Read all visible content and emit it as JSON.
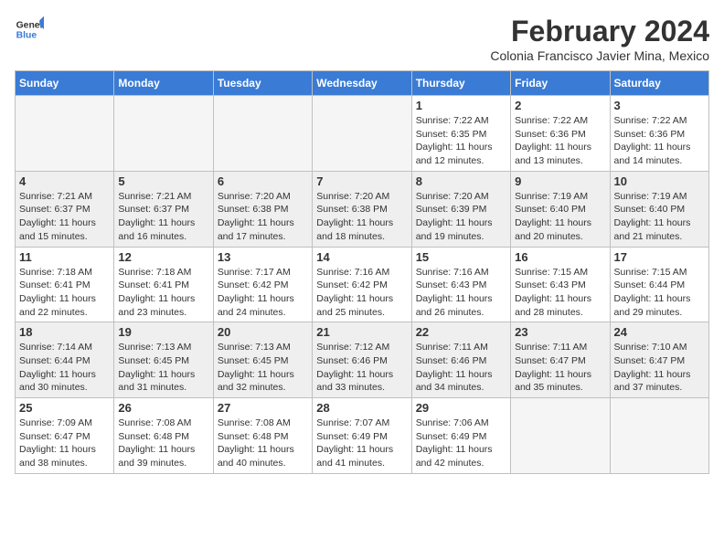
{
  "header": {
    "logo_general": "General",
    "logo_blue": "Blue",
    "month_year": "February 2024",
    "location": "Colonia Francisco Javier Mina, Mexico"
  },
  "days_of_week": [
    "Sunday",
    "Monday",
    "Tuesday",
    "Wednesday",
    "Thursday",
    "Friday",
    "Saturday"
  ],
  "weeks": [
    {
      "shaded": false,
      "days": [
        {
          "num": "",
          "info": ""
        },
        {
          "num": "",
          "info": ""
        },
        {
          "num": "",
          "info": ""
        },
        {
          "num": "",
          "info": ""
        },
        {
          "num": "1",
          "info": "Sunrise: 7:22 AM\nSunset: 6:35 PM\nDaylight: 11 hours\nand 12 minutes."
        },
        {
          "num": "2",
          "info": "Sunrise: 7:22 AM\nSunset: 6:36 PM\nDaylight: 11 hours\nand 13 minutes."
        },
        {
          "num": "3",
          "info": "Sunrise: 7:22 AM\nSunset: 6:36 PM\nDaylight: 11 hours\nand 14 minutes."
        }
      ]
    },
    {
      "shaded": true,
      "days": [
        {
          "num": "4",
          "info": "Sunrise: 7:21 AM\nSunset: 6:37 PM\nDaylight: 11 hours\nand 15 minutes."
        },
        {
          "num": "5",
          "info": "Sunrise: 7:21 AM\nSunset: 6:37 PM\nDaylight: 11 hours\nand 16 minutes."
        },
        {
          "num": "6",
          "info": "Sunrise: 7:20 AM\nSunset: 6:38 PM\nDaylight: 11 hours\nand 17 minutes."
        },
        {
          "num": "7",
          "info": "Sunrise: 7:20 AM\nSunset: 6:38 PM\nDaylight: 11 hours\nand 18 minutes."
        },
        {
          "num": "8",
          "info": "Sunrise: 7:20 AM\nSunset: 6:39 PM\nDaylight: 11 hours\nand 19 minutes."
        },
        {
          "num": "9",
          "info": "Sunrise: 7:19 AM\nSunset: 6:40 PM\nDaylight: 11 hours\nand 20 minutes."
        },
        {
          "num": "10",
          "info": "Sunrise: 7:19 AM\nSunset: 6:40 PM\nDaylight: 11 hours\nand 21 minutes."
        }
      ]
    },
    {
      "shaded": false,
      "days": [
        {
          "num": "11",
          "info": "Sunrise: 7:18 AM\nSunset: 6:41 PM\nDaylight: 11 hours\nand 22 minutes."
        },
        {
          "num": "12",
          "info": "Sunrise: 7:18 AM\nSunset: 6:41 PM\nDaylight: 11 hours\nand 23 minutes."
        },
        {
          "num": "13",
          "info": "Sunrise: 7:17 AM\nSunset: 6:42 PM\nDaylight: 11 hours\nand 24 minutes."
        },
        {
          "num": "14",
          "info": "Sunrise: 7:16 AM\nSunset: 6:42 PM\nDaylight: 11 hours\nand 25 minutes."
        },
        {
          "num": "15",
          "info": "Sunrise: 7:16 AM\nSunset: 6:43 PM\nDaylight: 11 hours\nand 26 minutes."
        },
        {
          "num": "16",
          "info": "Sunrise: 7:15 AM\nSunset: 6:43 PM\nDaylight: 11 hours\nand 28 minutes."
        },
        {
          "num": "17",
          "info": "Sunrise: 7:15 AM\nSunset: 6:44 PM\nDaylight: 11 hours\nand 29 minutes."
        }
      ]
    },
    {
      "shaded": true,
      "days": [
        {
          "num": "18",
          "info": "Sunrise: 7:14 AM\nSunset: 6:44 PM\nDaylight: 11 hours\nand 30 minutes."
        },
        {
          "num": "19",
          "info": "Sunrise: 7:13 AM\nSunset: 6:45 PM\nDaylight: 11 hours\nand 31 minutes."
        },
        {
          "num": "20",
          "info": "Sunrise: 7:13 AM\nSunset: 6:45 PM\nDaylight: 11 hours\nand 32 minutes."
        },
        {
          "num": "21",
          "info": "Sunrise: 7:12 AM\nSunset: 6:46 PM\nDaylight: 11 hours\nand 33 minutes."
        },
        {
          "num": "22",
          "info": "Sunrise: 7:11 AM\nSunset: 6:46 PM\nDaylight: 11 hours\nand 34 minutes."
        },
        {
          "num": "23",
          "info": "Sunrise: 7:11 AM\nSunset: 6:47 PM\nDaylight: 11 hours\nand 35 minutes."
        },
        {
          "num": "24",
          "info": "Sunrise: 7:10 AM\nSunset: 6:47 PM\nDaylight: 11 hours\nand 37 minutes."
        }
      ]
    },
    {
      "shaded": false,
      "days": [
        {
          "num": "25",
          "info": "Sunrise: 7:09 AM\nSunset: 6:47 PM\nDaylight: 11 hours\nand 38 minutes."
        },
        {
          "num": "26",
          "info": "Sunrise: 7:08 AM\nSunset: 6:48 PM\nDaylight: 11 hours\nand 39 minutes."
        },
        {
          "num": "27",
          "info": "Sunrise: 7:08 AM\nSunset: 6:48 PM\nDaylight: 11 hours\nand 40 minutes."
        },
        {
          "num": "28",
          "info": "Sunrise: 7:07 AM\nSunset: 6:49 PM\nDaylight: 11 hours\nand 41 minutes."
        },
        {
          "num": "29",
          "info": "Sunrise: 7:06 AM\nSunset: 6:49 PM\nDaylight: 11 hours\nand 42 minutes."
        },
        {
          "num": "",
          "info": ""
        },
        {
          "num": "",
          "info": ""
        }
      ]
    }
  ]
}
